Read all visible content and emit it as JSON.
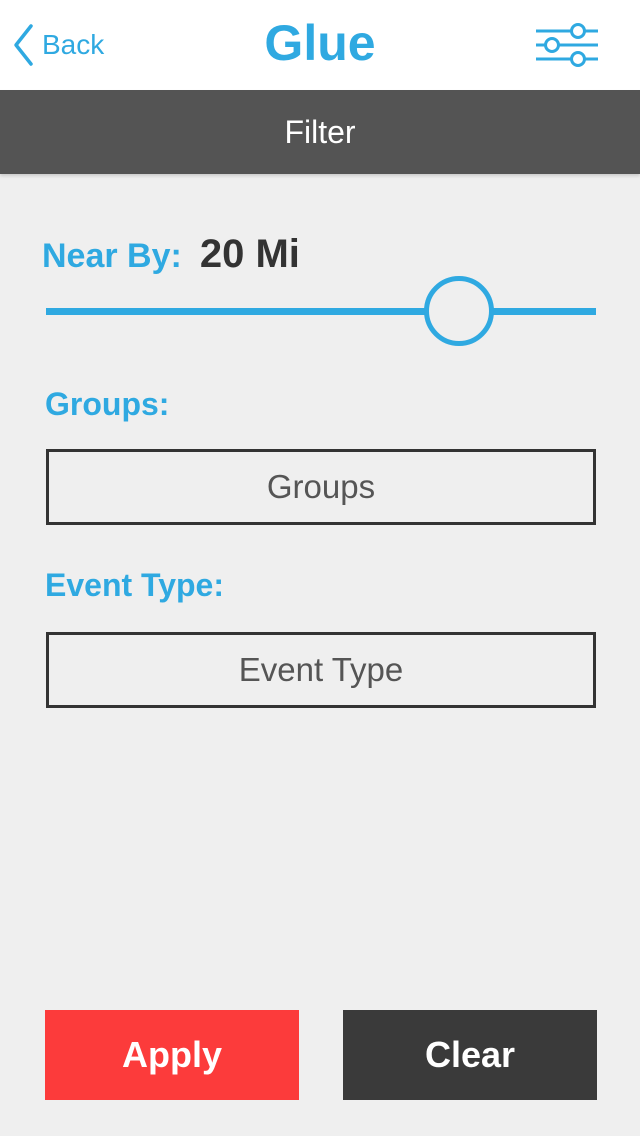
{
  "nav": {
    "back_label": "Back",
    "title": "Glue",
    "settings_icon": "sliders-icon",
    "accent_color": "#2fa9e1"
  },
  "header": {
    "title": "Filter"
  },
  "filter": {
    "near_by_label": "Near By:",
    "near_by_value": "20 Mi",
    "slider_level_fraction": 0.75,
    "groups_label": "Groups:",
    "groups_placeholder": "Groups",
    "event_type_label": "Event Type:",
    "event_type_placeholder": "Event Type"
  },
  "actions": {
    "apply_label": "Apply",
    "apply_color": "#fc3b3b",
    "clear_label": "Clear",
    "clear_color": "#3a3a3a"
  }
}
